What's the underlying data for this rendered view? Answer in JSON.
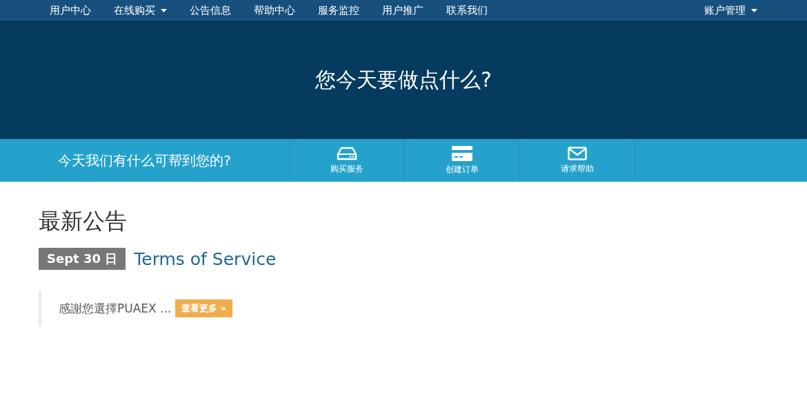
{
  "nav": {
    "items": [
      {
        "label": "用户中心",
        "dropdown": false
      },
      {
        "label": "在线购买",
        "dropdown": true
      },
      {
        "label": "公告信息",
        "dropdown": false
      },
      {
        "label": "帮助中心",
        "dropdown": false
      },
      {
        "label": "服务监控",
        "dropdown": false
      },
      {
        "label": "用户推广",
        "dropdown": false
      },
      {
        "label": "联系我们",
        "dropdown": false
      }
    ],
    "account": {
      "label": "账户管理",
      "dropdown": true
    }
  },
  "hero": {
    "title": "您今天要做点什么?"
  },
  "quick": {
    "prompt": "今天我们有什么可帮到您的?",
    "actions": [
      {
        "label": "购买服务",
        "kind": "server"
      },
      {
        "label": "创建订单",
        "kind": "card"
      },
      {
        "label": "请求帮助",
        "kind": "mail"
      }
    ]
  },
  "announcements": {
    "heading": "最新公告",
    "items": [
      {
        "date": "Sept 30 日",
        "title": "Terms of Service",
        "excerpt": "感謝您選擇PUAEX ...",
        "more": "查看更多 »"
      }
    ]
  }
}
